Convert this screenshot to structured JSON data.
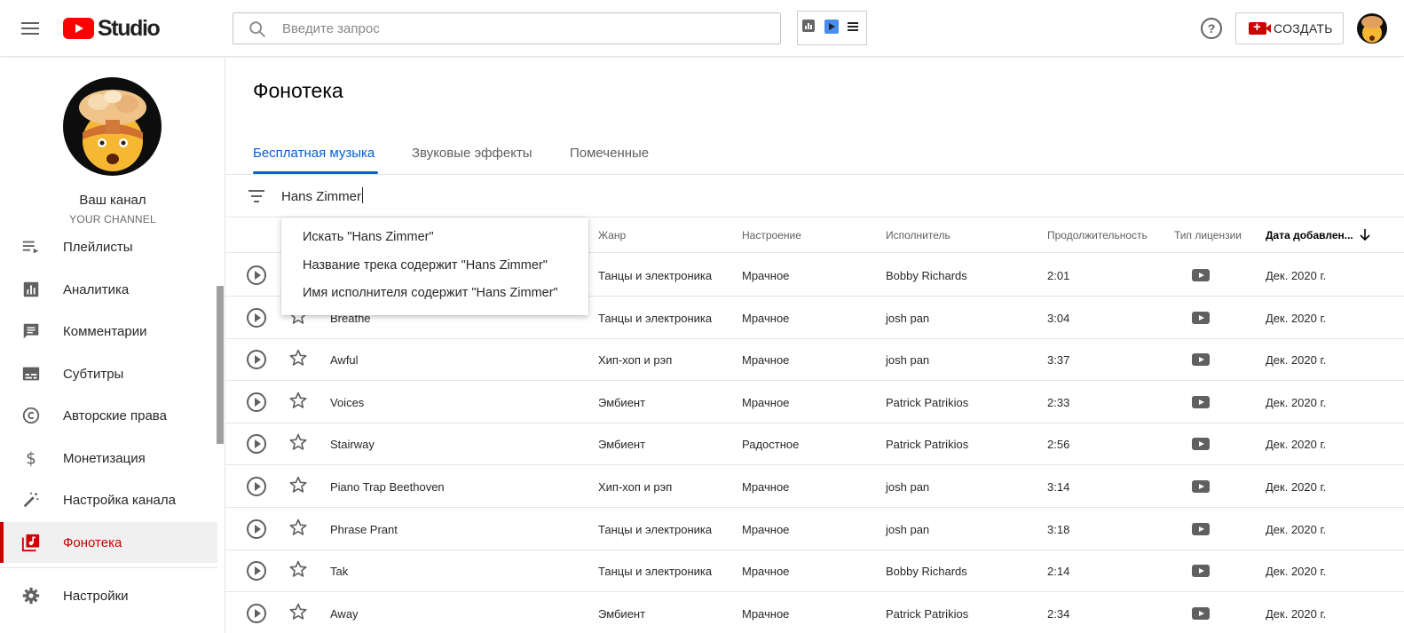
{
  "header": {
    "logo_text": "Studio",
    "search_placeholder": "Введите запрос",
    "help_glyph": "?",
    "create_label": "СОЗДАТЬ"
  },
  "sidebar": {
    "channel_title": "Ваш канал",
    "channel_subtitle": "YOUR CHANNEL",
    "items": [
      {
        "label": "Плейлисты",
        "icon": "playlist-icon"
      },
      {
        "label": "Аналитика",
        "icon": "analytics-icon"
      },
      {
        "label": "Комментарии",
        "icon": "comments-icon"
      },
      {
        "label": "Субтитры",
        "icon": "subtitles-icon"
      },
      {
        "label": "Авторские права",
        "icon": "copyright-icon"
      },
      {
        "label": "Монетизация",
        "icon": "dollar-icon"
      },
      {
        "label": "Настройка канала",
        "icon": "magic-wand-icon"
      },
      {
        "label": "Фонотека",
        "icon": "audio-library-icon",
        "active": true
      },
      {
        "label": "Настройки",
        "icon": "gear-icon"
      }
    ]
  },
  "main": {
    "title": "Фонотека",
    "tabs": [
      "Бесплатная музыка",
      "Звуковые эффекты",
      "Помеченные"
    ],
    "active_tab": 0,
    "filter_value": "Hans Zimmer",
    "columns": {
      "genre": "Жанр",
      "mood": "Настроение",
      "artist": "Исполнитель",
      "duration": "Продолжительность",
      "license": "Тип лицензии",
      "date_added": "Дата добавлен..."
    },
    "dropdown": [
      "Искать \"Hans Zimmer\"",
      "Название трека содержит \"Hans Zimmer\"",
      "Имя исполнителя содержит \"Hans Zimmer\""
    ],
    "rows": [
      {
        "title": "",
        "genre": "Танцы и электроника",
        "mood": "Мрачное",
        "artist": "Bobby Richards",
        "duration": "2:01",
        "date": "Дек. 2020 г."
      },
      {
        "title": "Breathe",
        "genre": "Танцы и электроника",
        "mood": "Мрачное",
        "artist": "josh pan",
        "duration": "3:04",
        "date": "Дек. 2020 г."
      },
      {
        "title": "Awful",
        "genre": "Хип-хоп и рэп",
        "mood": "Мрачное",
        "artist": "josh pan",
        "duration": "3:37",
        "date": "Дек. 2020 г."
      },
      {
        "title": "Voices",
        "genre": "Эмбиент",
        "mood": "Мрачное",
        "artist": "Patrick Patrikios",
        "duration": "2:33",
        "date": "Дек. 2020 г."
      },
      {
        "title": "Stairway",
        "genre": "Эмбиент",
        "mood": "Радостное",
        "artist": "Patrick Patrikios",
        "duration": "2:56",
        "date": "Дек. 2020 г."
      },
      {
        "title": "Piano Trap Beethoven",
        "genre": "Хип-хоп и рэп",
        "mood": "Мрачное",
        "artist": "josh pan",
        "duration": "3:14",
        "date": "Дек. 2020 г."
      },
      {
        "title": "Phrase Prant",
        "genre": "Танцы и электроника",
        "mood": "Мрачное",
        "artist": "josh pan",
        "duration": "3:18",
        "date": "Дек. 2020 г."
      },
      {
        "title": "Tak",
        "genre": "Танцы и электроника",
        "mood": "Мрачное",
        "artist": "Bobby Richards",
        "duration": "2:14",
        "date": "Дек. 2020 г."
      },
      {
        "title": "Away",
        "genre": "Эмбиент",
        "mood": "Мрачное",
        "artist": "Patrick Patrikios",
        "duration": "2:34",
        "date": "Дек. 2020 г."
      }
    ]
  },
  "colors": {
    "accent_blue": "#065fd4",
    "brand_red": "#ff0000",
    "active_red": "#cc0000"
  }
}
